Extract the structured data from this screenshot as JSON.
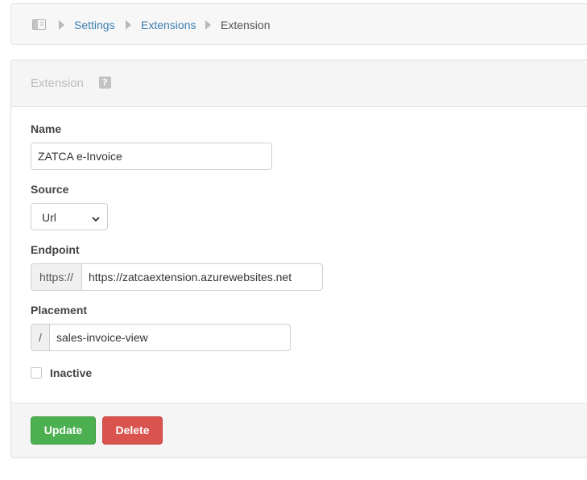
{
  "breadcrumb": {
    "home_icon": "sidebar-panel-icon",
    "items": [
      {
        "label": "Settings"
      },
      {
        "label": "Extensions"
      }
    ],
    "current": "Extension"
  },
  "panel": {
    "title": "Extension",
    "help_glyph": "?"
  },
  "form": {
    "name": {
      "label": "Name",
      "value": "ZATCA e-Invoice"
    },
    "source": {
      "label": "Source",
      "selected": "Url"
    },
    "endpoint": {
      "label": "Endpoint",
      "prefix": "https://",
      "value": "https://zatcaextension.azurewebsites.net"
    },
    "placement": {
      "label": "Placement",
      "prefix": "/",
      "value": "sales-invoice-view"
    },
    "inactive": {
      "label": "Inactive",
      "checked": false
    }
  },
  "actions": {
    "update_label": "Update",
    "delete_label": "Delete"
  },
  "colors": {
    "link": "#3c7fb1",
    "update_button": "#4cb050",
    "delete_button": "#d9534f"
  }
}
